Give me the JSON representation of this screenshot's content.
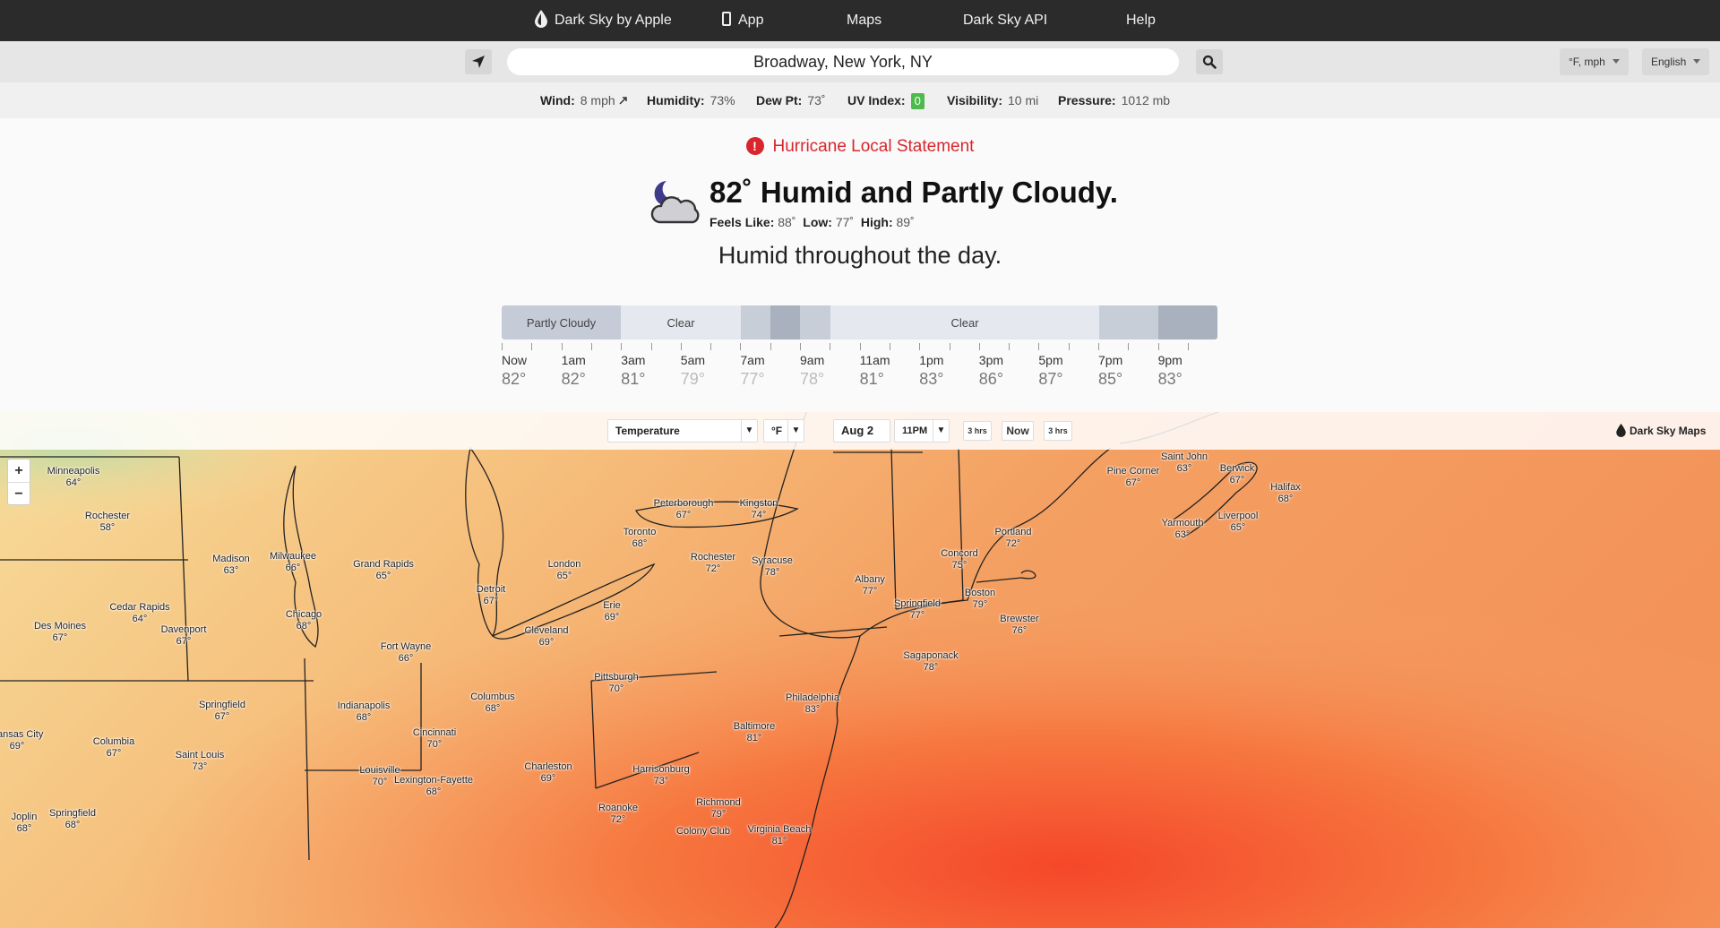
{
  "nav": {
    "brand": "Dark Sky by Apple",
    "app": "App",
    "maps": "Maps",
    "api": "Dark Sky API",
    "help": "Help"
  },
  "search": {
    "value": "Broadway, New York, NY",
    "units": "°F, mph",
    "language": "English"
  },
  "conditions": {
    "wind_label": "Wind:",
    "wind_value": "8 mph",
    "humidity_label": "Humidity:",
    "humidity_value": "73%",
    "dew_label": "Dew Pt:",
    "dew_value": "73˚",
    "uv_label": "UV Index:",
    "uv_value": "0",
    "visibility_label": "Visibility:",
    "visibility_value": "10 mi",
    "pressure_label": "Pressure:",
    "pressure_value": "1012 mb"
  },
  "alert": {
    "text": "Hurricane Local Statement",
    "color": "#d8262e"
  },
  "current": {
    "icon": "partly-cloudy-night-icon",
    "summary": "82˚ Humid and Partly Cloudy.",
    "feels_label": "Feels Like:",
    "feels_value": "88˚",
    "low_label": "Low:",
    "low_value": "77˚",
    "high_label": "High:",
    "high_value": "89˚"
  },
  "day_summary": "Humid throughout the day.",
  "timeline": {
    "segments": [
      {
        "label": "Partly Cloudy",
        "color": "#c5ccd8"
      },
      {
        "label": "Clear",
        "color": "#e6e8f0"
      },
      {
        "label": "",
        "color": "#c8ced8"
      },
      {
        "label": "",
        "color": "#a9b1bf"
      },
      {
        "label": "",
        "color": "#c8ced8"
      },
      {
        "label": "Clear",
        "color": "#e6e8f0"
      },
      {
        "label": "",
        "color": "#c8ced8"
      },
      {
        "label": "",
        "color": "#a9b1bf"
      }
    ],
    "hours": [
      {
        "label": "Now",
        "temp": "82°"
      },
      {
        "label": "1am",
        "temp": "82°"
      },
      {
        "label": "3am",
        "temp": "81°"
      },
      {
        "label": "5am",
        "temp": "79°"
      },
      {
        "label": "7am",
        "temp": "77°"
      },
      {
        "label": "9am",
        "temp": "78°"
      },
      {
        "label": "11am",
        "temp": "81°"
      },
      {
        "label": "1pm",
        "temp": "83°"
      },
      {
        "label": "3pm",
        "temp": "86°"
      },
      {
        "label": "5pm",
        "temp": "87°"
      },
      {
        "label": "7pm",
        "temp": "85°"
      },
      {
        "label": "9pm",
        "temp": "83°"
      }
    ]
  },
  "map": {
    "layer": "Temperature",
    "unit": "°F",
    "date": "Aug 2",
    "time": "11PM",
    "back": "3 hrs",
    "now": "Now",
    "forward": "3 hrs",
    "brand": "Dark Sky Maps",
    "zoom_in": "+",
    "zoom_out": "−",
    "cities": [
      {
        "name": "Minneapolis",
        "temp": "64°"
      },
      {
        "name": "Rochester",
        "temp": "58°"
      },
      {
        "name": "Madison",
        "temp": "63°"
      },
      {
        "name": "Milwaukee",
        "temp": "66°"
      },
      {
        "name": "Grand Rapids",
        "temp": "65°"
      },
      {
        "name": "Cedar Rapids",
        "temp": "64°"
      },
      {
        "name": "Des Moines",
        "temp": "67°"
      },
      {
        "name": "Davenport",
        "temp": "67°"
      },
      {
        "name": "Chicago",
        "temp": "68°"
      },
      {
        "name": "Detroit",
        "temp": "67°"
      },
      {
        "name": "London",
        "temp": "65°"
      },
      {
        "name": "Toronto",
        "temp": "68°"
      },
      {
        "name": "Peterborough",
        "temp": "67°"
      },
      {
        "name": "Kingston",
        "temp": "74°"
      },
      {
        "name": "Rochester",
        "temp": "72°"
      },
      {
        "name": "Syracuse",
        "temp": "78°"
      },
      {
        "name": "Erie",
        "temp": "69°"
      },
      {
        "name": "Cleveland",
        "temp": "69°"
      },
      {
        "name": "Fort Wayne",
        "temp": "66°"
      },
      {
        "name": "Pittsburgh",
        "temp": "70°"
      },
      {
        "name": "Columbus",
        "temp": "68°"
      },
      {
        "name": "Indianapolis",
        "temp": "68°"
      },
      {
        "name": "Springfield",
        "temp": "67°"
      },
      {
        "name": "Cincinnati",
        "temp": "70°"
      },
      {
        "name": "Louisville",
        "temp": "70°"
      },
      {
        "name": "Lexington-Fayette",
        "temp": "68°"
      },
      {
        "name": "Charleston",
        "temp": "69°"
      },
      {
        "name": "Harrisonburg",
        "temp": "73°"
      },
      {
        "name": "Roanoke",
        "temp": "72°"
      },
      {
        "name": "Richmond",
        "temp": "79°"
      },
      {
        "name": "Virginia Beach",
        "temp": "81°"
      },
      {
        "name": "Baltimore",
        "temp": "81°"
      },
      {
        "name": "Philadelphia",
        "temp": "83°"
      },
      {
        "name": "Albany",
        "temp": "77°"
      },
      {
        "name": "Springfield",
        "temp": "77°"
      },
      {
        "name": "Boston",
        "temp": "79°"
      },
      {
        "name": "Brewster",
        "temp": "76°"
      },
      {
        "name": "Sagaponack",
        "temp": "78°"
      },
      {
        "name": "Concord",
        "temp": "75°"
      },
      {
        "name": "Portland",
        "temp": "72°"
      },
      {
        "name": "Saint John",
        "temp": "63°"
      },
      {
        "name": "Pine Corner",
        "temp": "67°"
      },
      {
        "name": "Berwick",
        "temp": "67°"
      },
      {
        "name": "Halifax",
        "temp": "68°"
      },
      {
        "name": "Yarmouth",
        "temp": "63°"
      },
      {
        "name": "Liverpool",
        "temp": "65°"
      },
      {
        "name": "Saint Louis",
        "temp": "73°"
      },
      {
        "name": "Columbia",
        "temp": "67°"
      },
      {
        "name": "Kansas City",
        "temp": "69°"
      },
      {
        "name": "Joplin",
        "temp": "68°"
      },
      {
        "name": "Springfield",
        "temp": "68°"
      },
      {
        "name": "Springfield",
        "temp": "67°"
      },
      {
        "name": "Colony Club",
        "temp": ""
      }
    ]
  }
}
